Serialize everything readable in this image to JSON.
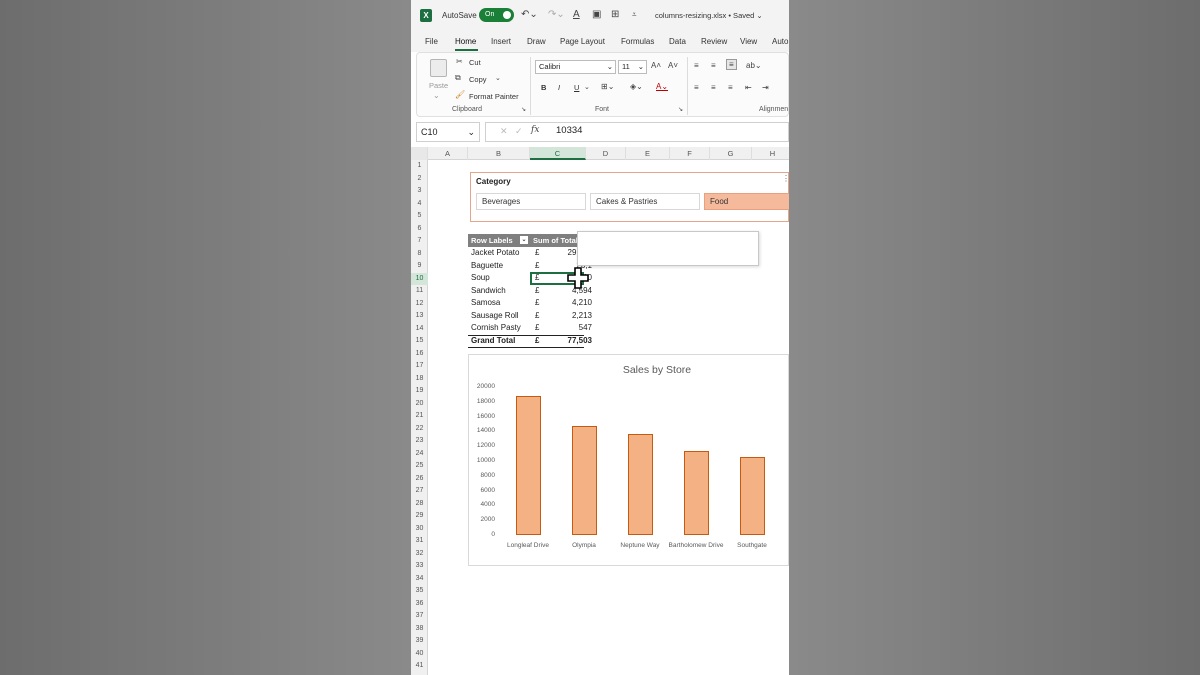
{
  "titlebar": {
    "autosave_label": "AutoSave",
    "autosave_state": "On",
    "filename": "columns-resizing.xlsx • Saved ⌄"
  },
  "menu": {
    "tabs": [
      "File",
      "Home",
      "Insert",
      "Draw",
      "Page Layout",
      "Formulas",
      "Data",
      "Review",
      "View",
      "Auto"
    ]
  },
  "ribbon": {
    "paste": "Paste",
    "cut": "Cut",
    "copy": "Copy",
    "format_painter": "Format Painter",
    "clipboard_label": "Clipboard",
    "font_name": "Calibri",
    "font_size": "11",
    "font_label": "Font",
    "bold": "B",
    "italic": "I",
    "underline": "U",
    "alignment_label": "Alignmen"
  },
  "formula_bar": {
    "name_box": "C10",
    "fx": "fx",
    "value": "10334"
  },
  "columns": [
    "A",
    "B",
    "C",
    "D",
    "E",
    "F",
    "G",
    "H"
  ],
  "rows": [
    "1",
    "2",
    "3",
    "4",
    "5",
    "6",
    "7",
    "8",
    "9",
    "10",
    "11",
    "12",
    "13",
    "14",
    "15",
    "16",
    "17",
    "18",
    "19",
    "20",
    "21",
    "22",
    "23",
    "24",
    "25",
    "26",
    "27",
    "28",
    "29",
    "30",
    "31",
    "32",
    "33",
    "34",
    "35",
    "36",
    "37",
    "38",
    "39",
    "40",
    "41"
  ],
  "slicer": {
    "title": "Category",
    "items": [
      {
        "label": "Beverages",
        "selected": false
      },
      {
        "label": "Cakes & Pastries",
        "selected": false
      },
      {
        "label": "Food",
        "selected": true
      }
    ]
  },
  "pivot": {
    "header_row_labels": "Row Labels",
    "header_sum": "Sum of Total",
    "rows": [
      {
        "label": "Jacket Potato",
        "currency": "£",
        "value": "29,482"
      },
      {
        "label": "Baguette",
        "currency": "£",
        "value": "26,1"
      },
      {
        "label": "Soup",
        "currency": "£",
        "value": "10"
      },
      {
        "label": "Sandwich",
        "currency": "£",
        "value": "4,594"
      },
      {
        "label": "Samosa",
        "currency": "£",
        "value": "4,210"
      },
      {
        "label": "Sausage Roll",
        "currency": "£",
        "value": "2,213"
      },
      {
        "label": "Cornish Pasty",
        "currency": "£",
        "value": "547"
      }
    ],
    "grand_total": {
      "label": "Grand Total",
      "currency": "£",
      "value": "77,503"
    }
  },
  "chart_data": {
    "type": "bar",
    "title": "Sales by Store",
    "categories": [
      "Longleaf Drive",
      "Olympia",
      "Neptune Way",
      "Bartholomew Drive",
      "Southgate"
    ],
    "values": [
      18800,
      14700,
      13700,
      11400,
      10600
    ],
    "yticks": [
      "20000",
      "18000",
      "16000",
      "14000",
      "12000",
      "10000",
      "8000",
      "6000",
      "4000",
      "2000",
      "0"
    ],
    "ylim": [
      0,
      20000
    ],
    "xlabel": "",
    "ylabel": "",
    "bar_color": "#f4b183"
  },
  "colors": {
    "excel_green": "#1d6f42",
    "slicer_selected": "#f5b99b",
    "pivot_header": "#7f7f7f"
  }
}
